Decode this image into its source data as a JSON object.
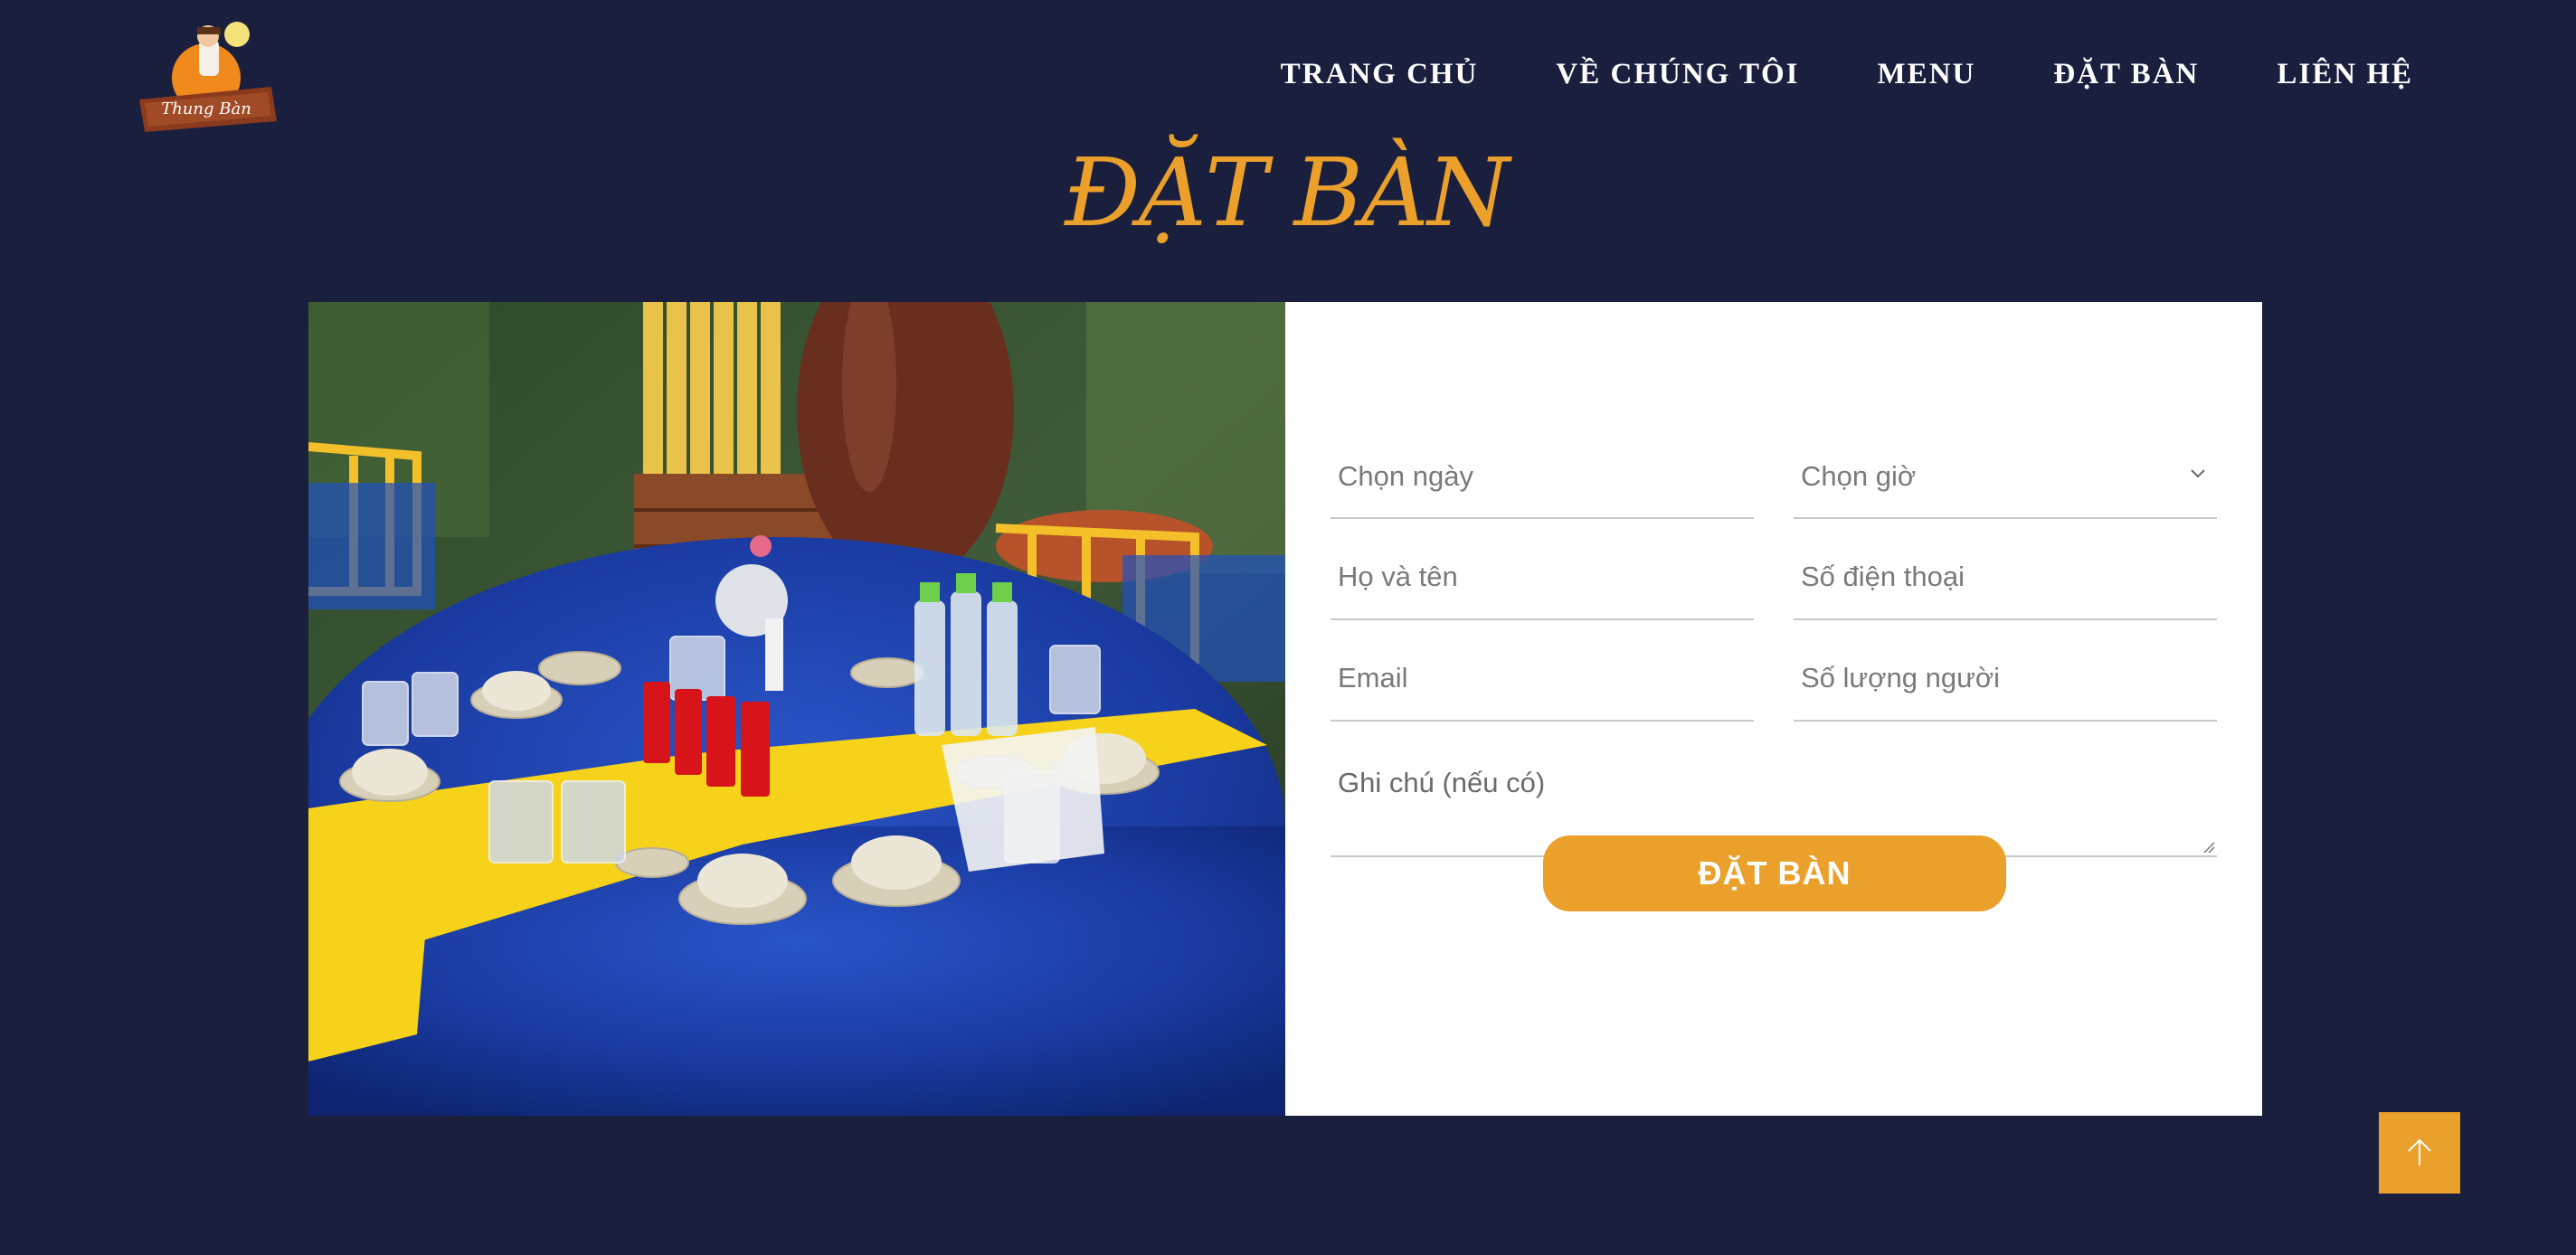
{
  "brand": {
    "logo_alt": "restaurant-logo",
    "logo_text": "Thung Bàn"
  },
  "nav": {
    "items": [
      "TRANG CHỦ",
      "VỀ CHÚNG TÔI",
      "MENU",
      "ĐẶT BÀN",
      "LIÊN HỆ"
    ]
  },
  "page": {
    "title": "ĐẶT BÀN"
  },
  "form": {
    "date_placeholder": "Chọn ngày",
    "time_placeholder": "Chọn giờ",
    "name_placeholder": "Họ và tên",
    "phone_placeholder": "Số điện thoại",
    "email_placeholder": "Email",
    "guests_placeholder": "Số lượng người",
    "note_placeholder": "Ghi chú (nếu có)",
    "submit_label": "ĐẶT BÀN"
  },
  "icons": {
    "time_select": "chevron-down-icon",
    "back_to_top": "arrow-up-icon"
  },
  "colors": {
    "background": "#1a1f3d",
    "accent": "#eaa02a",
    "panel": "#ffffff"
  }
}
